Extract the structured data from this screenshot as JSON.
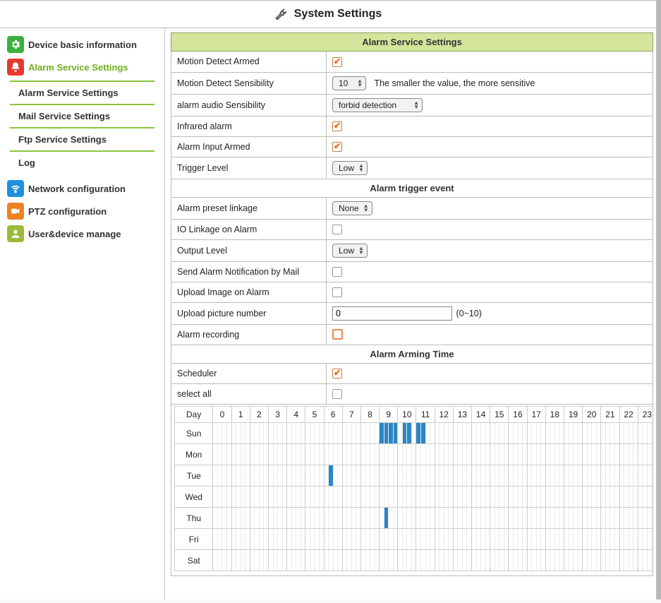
{
  "title": "System Settings",
  "sidebar": {
    "items": [
      {
        "label": "Device basic information"
      },
      {
        "label": "Alarm Service Settings"
      },
      {
        "label": "Network configuration"
      },
      {
        "label": "PTZ configuration"
      },
      {
        "label": "User&device manage"
      }
    ],
    "sub_items": [
      {
        "label": "Alarm Service Settings"
      },
      {
        "label": "Mail Service Settings"
      },
      {
        "label": "Ftp Service Settings"
      },
      {
        "label": "Log"
      }
    ]
  },
  "sections": {
    "alarm_service": "Alarm Service Settings",
    "trigger_event": "Alarm trigger event",
    "arming_time": "Alarm Arming Time"
  },
  "fields": {
    "motion_detect_armed": {
      "label": "Motion Detect Armed",
      "checked": true
    },
    "motion_detect_sens": {
      "label": "Motion Detect Sensibility",
      "value": "10",
      "hint": "The smaller the value, the more sensitive"
    },
    "alarm_audio_sens": {
      "label": "alarm audio Sensibility",
      "value": "forbid detection"
    },
    "infrared_alarm": {
      "label": "Infrared alarm",
      "checked": true
    },
    "alarm_input_armed": {
      "label": "Alarm Input Armed",
      "checked": true
    },
    "trigger_level": {
      "label": "Trigger Level",
      "value": "Low"
    },
    "alarm_preset_linkage": {
      "label": "Alarm preset linkage",
      "value": "None"
    },
    "io_linkage": {
      "label": "IO Linkage on Alarm",
      "checked": false
    },
    "output_level": {
      "label": "Output Level",
      "value": "Low"
    },
    "send_mail": {
      "label": "Send Alarm Notification by Mail",
      "checked": false
    },
    "upload_image": {
      "label": "Upload Image on Alarm",
      "checked": false
    },
    "upload_pic_number": {
      "label": "Upload picture number",
      "value": "0",
      "hint": "(0~10)"
    },
    "alarm_recording": {
      "label": "Alarm recording",
      "checked": false
    },
    "scheduler": {
      "label": "Scheduler",
      "checked": true
    },
    "select_all": {
      "label": "select all",
      "checked": false
    }
  },
  "schedule": {
    "day_header": "Day",
    "hours": [
      "0",
      "1",
      "2",
      "3",
      "4",
      "5",
      "6",
      "7",
      "8",
      "9",
      "10",
      "11",
      "12",
      "13",
      "14",
      "15",
      "16",
      "17",
      "18",
      "19",
      "20",
      "21",
      "22",
      "23"
    ],
    "days": [
      "Sun",
      "Mon",
      "Tue",
      "Wed",
      "Thu",
      "Fri",
      "Sat"
    ],
    "selected": {
      "Sun": [
        36,
        37,
        38,
        39,
        41,
        42,
        44,
        45
      ],
      "Mon": [],
      "Tue": [
        25
      ],
      "Wed": [],
      "Thu": [
        37
      ],
      "Fri": [],
      "Sat": []
    }
  }
}
